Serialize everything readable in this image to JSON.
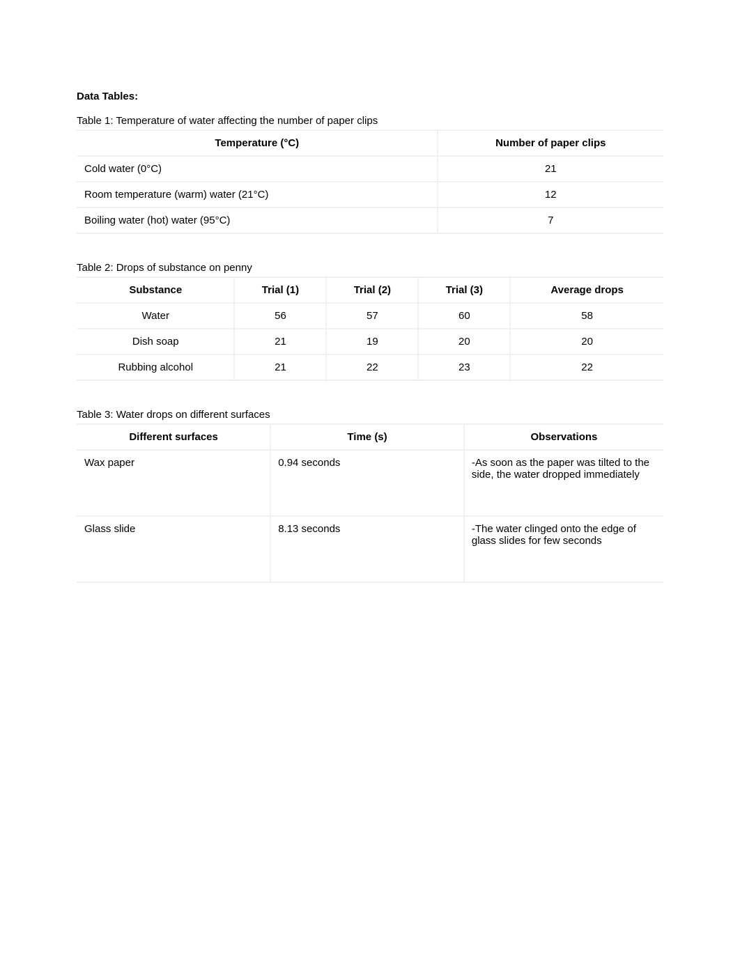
{
  "heading": "Data Tables:",
  "table1": {
    "caption": "Table 1: Temperature of water affecting the number of paper clips",
    "headers": [
      "Temperature (°C)",
      "Number of paper clips"
    ],
    "rows": [
      {
        "label": "Cold water (0°C)",
        "value": "21"
      },
      {
        "label": "Room temperature (warm) water (21°C)",
        "value": "12"
      },
      {
        "label": "Boiling water (hot) water (95°C)",
        "value": "7"
      }
    ]
  },
  "table2": {
    "caption": "Table 2: Drops of substance on penny",
    "headers": [
      "Substance",
      "Trial (1)",
      "Trial (2)",
      "Trial (3)",
      "Average drops"
    ],
    "rows": [
      {
        "c0": "Water",
        "c1": "56",
        "c2": "57",
        "c3": "60",
        "c4": "58"
      },
      {
        "c0": "Dish soap",
        "c1": "21",
        "c2": "19",
        "c3": "20",
        "c4": "20"
      },
      {
        "c0": "Rubbing alcohol",
        "c1": "21",
        "c2": "22",
        "c3": "23",
        "c4": "22"
      }
    ]
  },
  "table3": {
    "caption": "Table 3: Water drops on different surfaces",
    "headers": [
      "Different surfaces",
      "Time (s)",
      "Observations"
    ],
    "rows": [
      {
        "surface": "Wax paper",
        "time": "0.94 seconds",
        "obs": "-As soon as the paper was tilted to the side, the water dropped immediately"
      },
      {
        "surface": "Glass slide",
        "time": "8.13 seconds",
        "obs": "-The water clinged onto the edge of glass slides for few seconds"
      }
    ]
  }
}
